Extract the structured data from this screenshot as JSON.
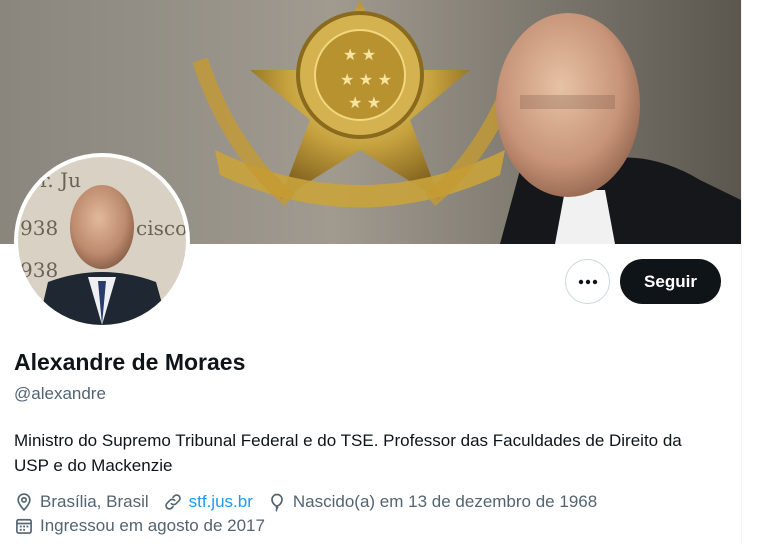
{
  "profile": {
    "name": "Alexandre de Moraes",
    "handle": "@alexandre",
    "bio": "Ministro do Supremo Tribunal Federal e do TSE. Professor das Faculdades de Direito da USP e do Mackenzie",
    "location": "Brasília, Brasil",
    "website": "stf.jus.br",
    "birthday": "Nascido(a) em 13 de dezembro de 1968",
    "joined": "Ingressou em agosto de 2017"
  },
  "actions": {
    "more_label": "•••",
    "follow_label": "Seguir"
  },
  "icons": {
    "location": "location-pin-icon",
    "website": "link-icon",
    "birthday": "balloon-icon",
    "joined": "calendar-icon",
    "more": "more-dots-icon"
  },
  "colors": {
    "follow_bg": "#0f1419",
    "link": "#1d9bf0",
    "secondary_text": "#536471"
  }
}
